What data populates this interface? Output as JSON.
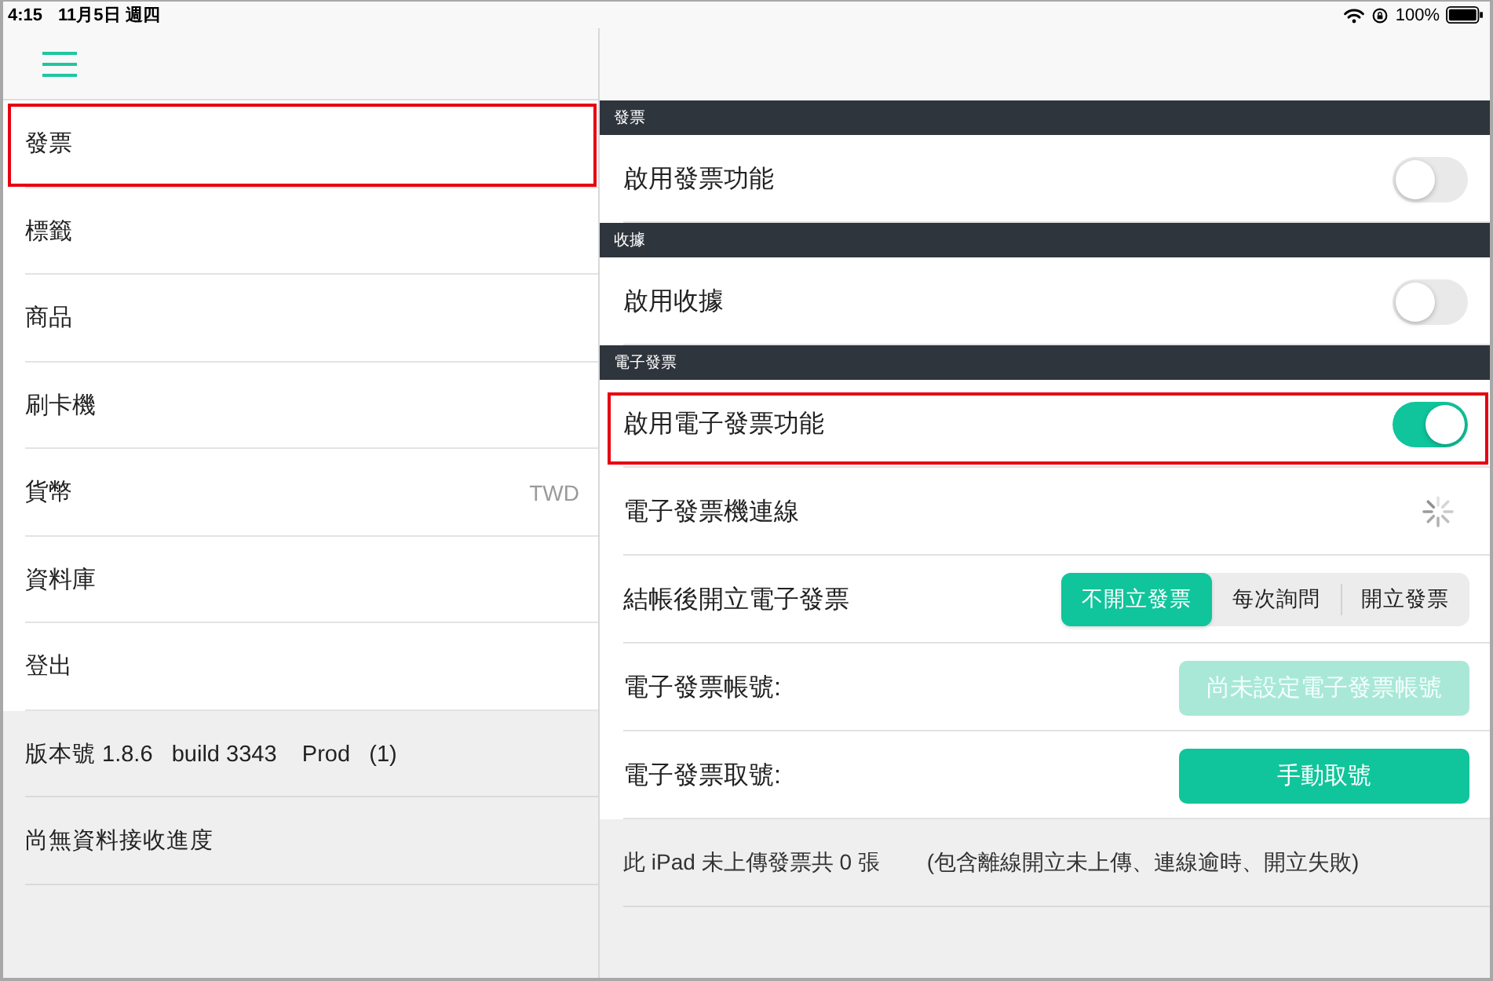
{
  "status_bar": {
    "time": "4:15",
    "date": "11月5日 週四",
    "battery": "100%"
  },
  "sidebar": {
    "items": [
      {
        "label": "發票",
        "highlighted": true
      },
      {
        "label": "標籤",
        "highlighted": false
      },
      {
        "label": "商品",
        "highlighted": false
      },
      {
        "label": "刷卡機",
        "highlighted": false
      },
      {
        "label": "貨幣",
        "value": "TWD",
        "highlighted": false
      },
      {
        "label": "資料庫",
        "highlighted": false
      },
      {
        "label": "登出",
        "highlighted": false
      }
    ],
    "info": [
      "版本號 1.8.6   build 3343    Prod   (1)",
      "尚無資料接收進度"
    ]
  },
  "sections": [
    {
      "title": "發票",
      "rows": [
        {
          "kind": "toggle",
          "label": "啟用發票功能",
          "on": false,
          "highlighted": false
        }
      ]
    },
    {
      "title": "收據",
      "rows": [
        {
          "kind": "toggle",
          "label": "啟用收據",
          "on": false,
          "highlighted": false
        }
      ]
    },
    {
      "title": "電子發票",
      "rows": [
        {
          "kind": "toggle",
          "label": "啟用電子發票功能",
          "on": true,
          "highlighted": true
        },
        {
          "kind": "loading",
          "label": "電子發票機連線",
          "highlighted": false
        },
        {
          "kind": "segmented",
          "label": "結帳後開立電子發票",
          "options": [
            {
              "label": "不開立發票",
              "selected": true
            },
            {
              "label": "每次詢問",
              "selected": false
            },
            {
              "label": "開立發票",
              "selected": false
            }
          ],
          "highlighted": false
        },
        {
          "kind": "button",
          "label": "電子發票帳號:",
          "button": "尚未設定電子發票帳號",
          "disabled": true,
          "highlighted": false
        },
        {
          "kind": "button",
          "label": "電子發票取號:",
          "button": "手動取號",
          "disabled": false,
          "highlighted": false
        }
      ]
    }
  ],
  "footer": {
    "note": "此 iPad 未上傳發票共 0 張",
    "detail": "(包含離線開立未上傳、連線逾時、開立失敗)"
  }
}
